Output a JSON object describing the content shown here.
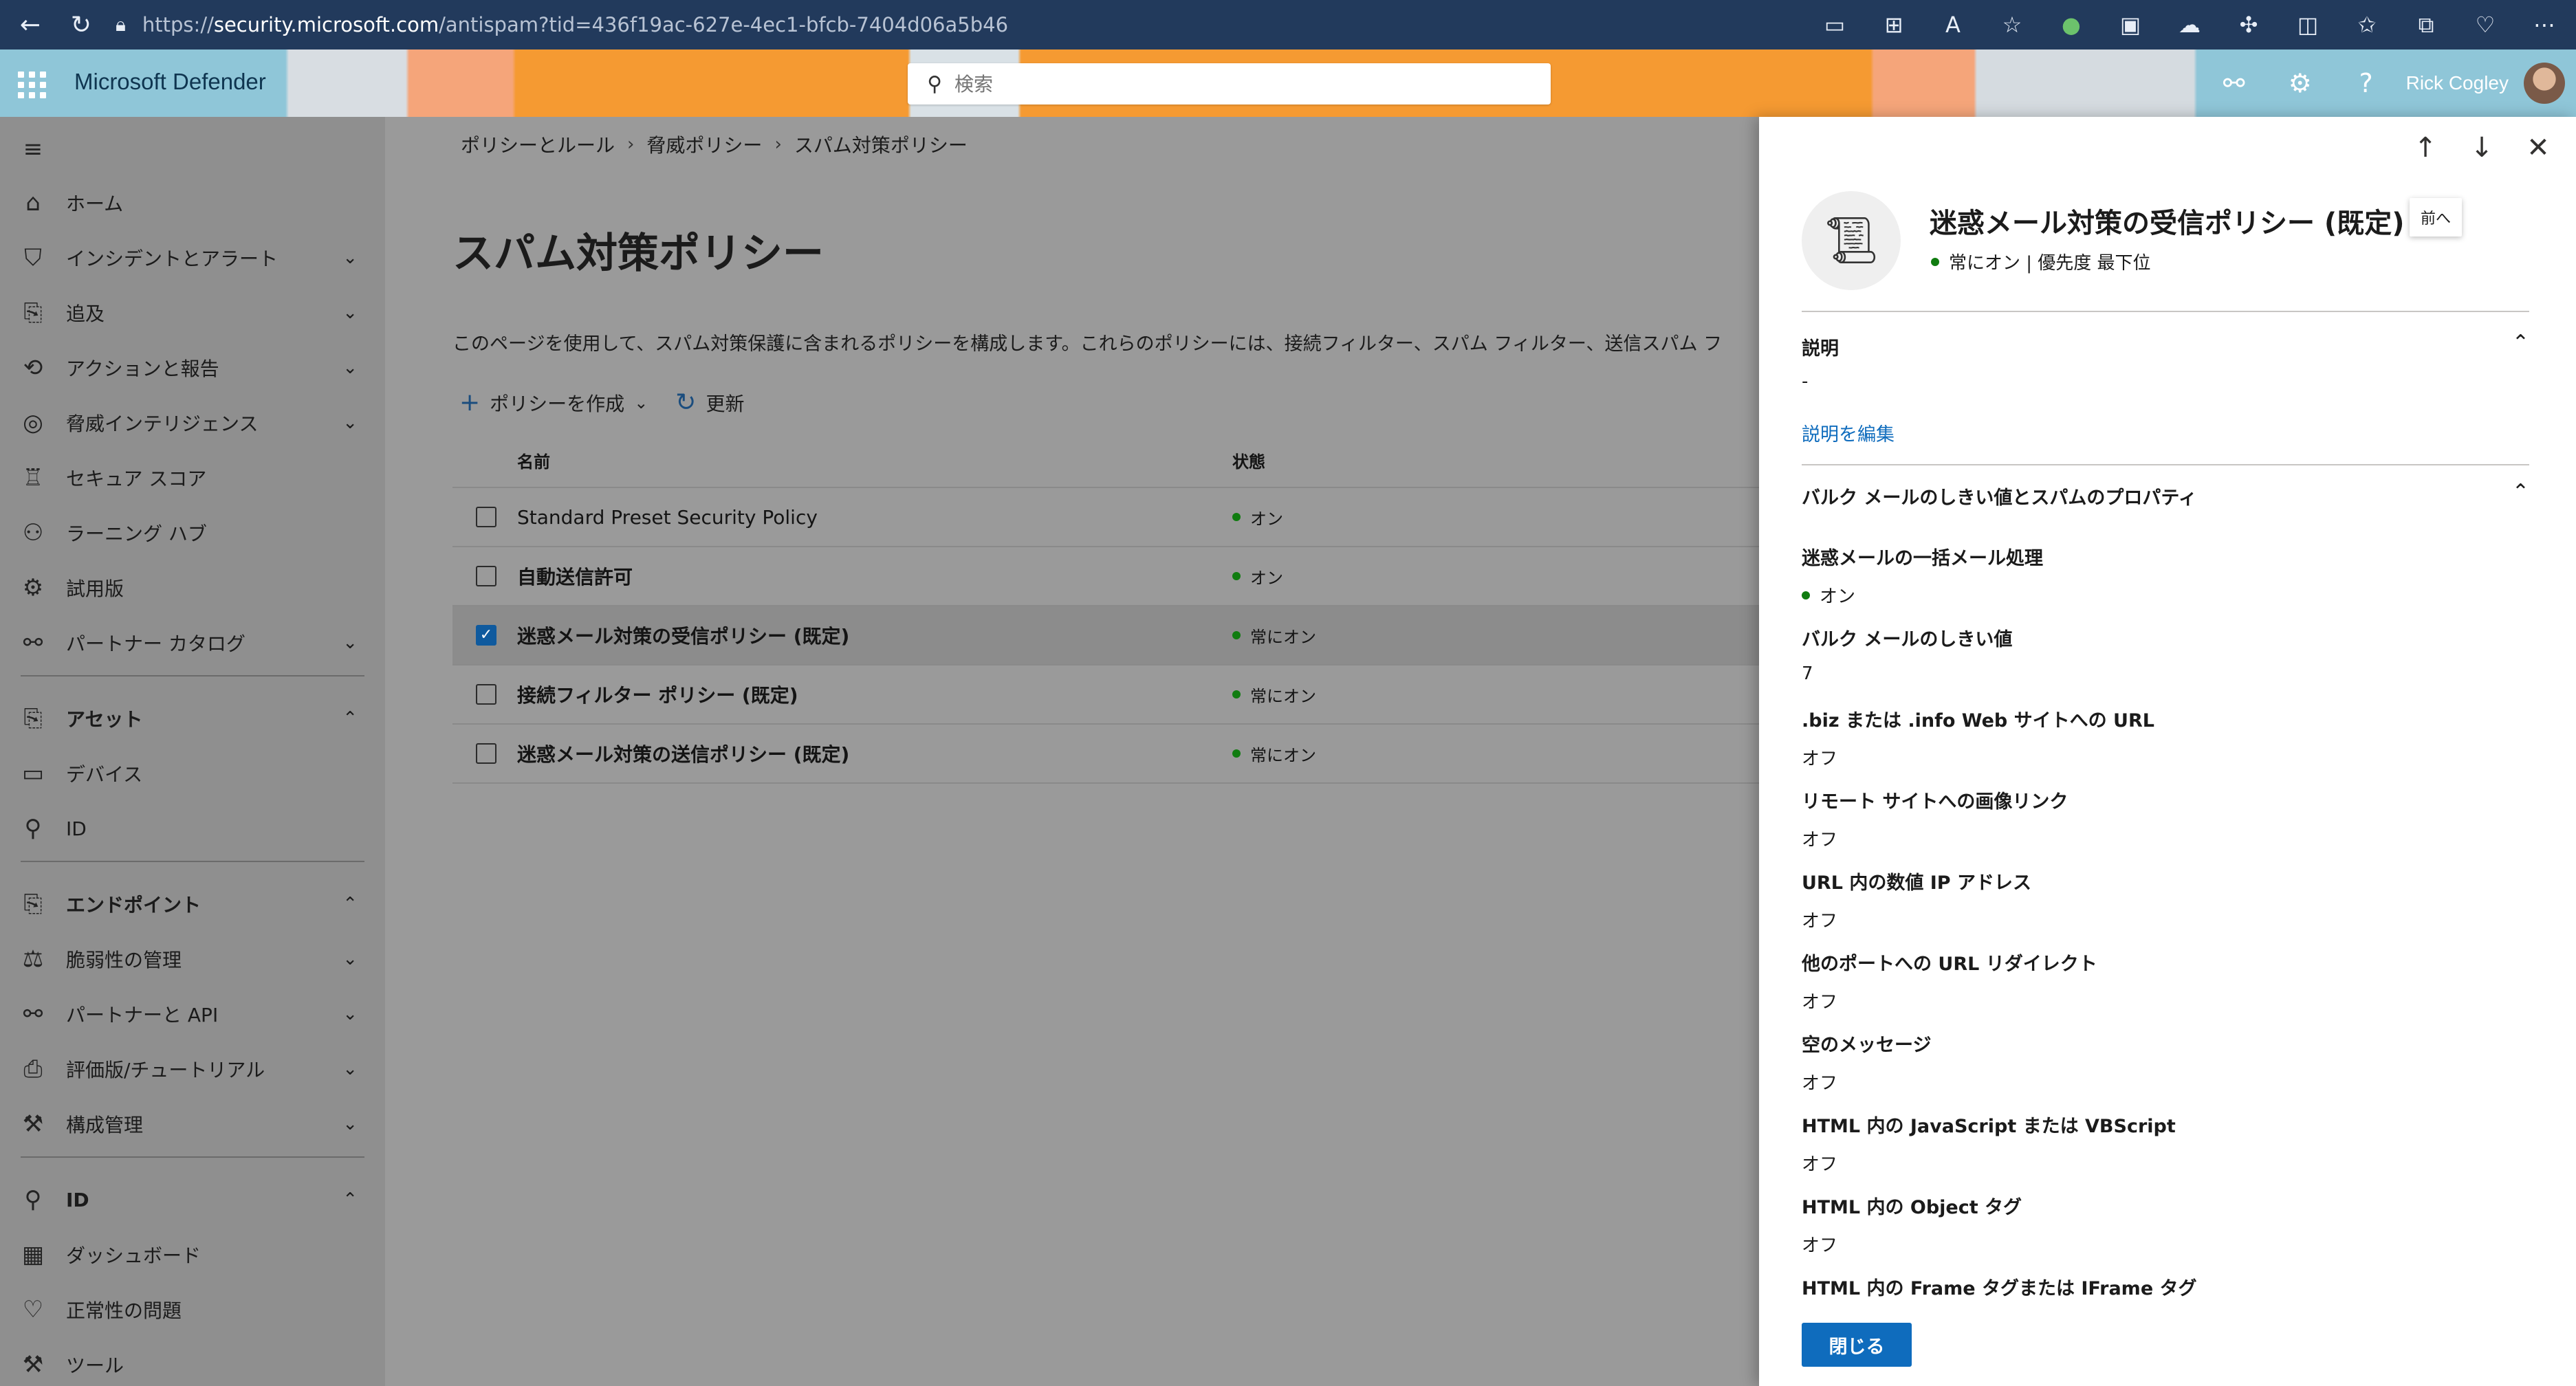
{
  "browser": {
    "url_prefix": "https://",
    "url_host": "security.microsoft.com",
    "url_path": "/antispam?tid=436f19ac-627e-4ec1-bfcb-7404d06a5b46"
  },
  "header": {
    "product": "Microsoft Defender",
    "search_placeholder": "検索",
    "user": "Rick Cogley"
  },
  "sidebar": {
    "items": [
      {
        "label": "ホーム",
        "icon": "home-icon",
        "glyph": "⌂",
        "chevron": ""
      },
      {
        "label": "インシデントとアラート",
        "icon": "shield-icon",
        "glyph": "⛉",
        "chevron": "⌄"
      },
      {
        "label": "追及",
        "icon": "hunting-icon",
        "glyph": "⎘",
        "chevron": "⌄"
      },
      {
        "label": "アクションと報告",
        "icon": "actions-icon",
        "glyph": "⟲",
        "chevron": "⌄"
      },
      {
        "label": "脅威インテリジェンス",
        "icon": "threat-intel-icon",
        "glyph": "◎",
        "chevron": "⌄"
      },
      {
        "label": "セキュア スコア",
        "icon": "trophy-icon",
        "glyph": "♖",
        "chevron": ""
      },
      {
        "label": "ラーニング ハブ",
        "icon": "learning-icon",
        "glyph": "⚇",
        "chevron": ""
      },
      {
        "label": "試用版",
        "icon": "trial-icon",
        "glyph": "⚙",
        "chevron": ""
      },
      {
        "label": "パートナー カタログ",
        "icon": "partner-icon",
        "glyph": "⚯",
        "chevron": "⌄"
      }
    ],
    "assets_head": {
      "label": "アセット",
      "chevron": "⌃"
    },
    "assets": [
      {
        "label": "デバイス",
        "icon": "device-icon",
        "glyph": "▭"
      },
      {
        "label": "ID",
        "icon": "person-icon",
        "glyph": "⚲"
      }
    ],
    "endpoint_head": {
      "label": "エンドポイント",
      "chevron": "⌃"
    },
    "endpoint": [
      {
        "label": "脆弱性の管理",
        "icon": "vulnerability-icon",
        "glyph": "⚖",
        "chevron": "⌄"
      },
      {
        "label": "パートナーと API",
        "icon": "api-icon",
        "glyph": "⚯",
        "chevron": "⌄"
      },
      {
        "label": "評価版/チュートリアル",
        "icon": "tutorial-icon",
        "glyph": "⎙",
        "chevron": "⌄"
      },
      {
        "label": "構成管理",
        "icon": "config-icon",
        "glyph": "⚒",
        "chevron": "⌄"
      }
    ],
    "id_head": {
      "label": "ID",
      "chevron": "⌃"
    },
    "id_items": [
      {
        "label": "ダッシュボード",
        "icon": "dashboard-icon",
        "glyph": "▦"
      },
      {
        "label": "正常性の問題",
        "icon": "health-icon",
        "glyph": "♡"
      },
      {
        "label": "ツール",
        "icon": "tools-icon",
        "glyph": "⚒"
      }
    ]
  },
  "breadcrumb": [
    "ポリシーとルール",
    "脅威ポリシー",
    "スパム対策ポリシー"
  ],
  "main": {
    "title": "スパム対策ポリシー",
    "description": "このページを使用して、スパム対策保護に含まれるポリシーを構成します。これらのポリシーには、接続フィルター、スパム フィルター、送信スパム フ",
    "create_label": "ポリシーを作成",
    "refresh_label": "更新"
  },
  "table": {
    "col_name": "名前",
    "col_status": "状態",
    "rows": [
      {
        "name": "Standard Preset Security Policy",
        "status": "オン",
        "checked": false
      },
      {
        "name": "自動送信許可",
        "status": "オン",
        "checked": false
      },
      {
        "name": "迷惑メール対策の受信ポリシー (既定)",
        "status": "常にオン",
        "checked": true
      },
      {
        "name": "接続フィルター ポリシー (既定)",
        "status": "常にオン",
        "checked": false
      },
      {
        "name": "迷惑メール対策の送信ポリシー (既定)",
        "status": "常にオン",
        "checked": false
      }
    ]
  },
  "panel": {
    "tooltip": "前へ",
    "title": "迷惑メール対策の受信ポリシー (既定)",
    "subtitle": "常にオン | 優先度 最下位",
    "description_head": "説明",
    "description_value": "-",
    "edit_description": "説明を編集",
    "bulk_head": "バルク メールのしきい値とスパムのプロパティ",
    "properties": [
      {
        "label": "迷惑メールの一括メール処理",
        "value": "オン",
        "dot": true
      },
      {
        "label": "バルク メールのしきい値",
        "value": "7",
        "dot": false
      },
      {
        "label": ".biz または .info Web サイトへの URL",
        "value": "オフ",
        "dot": false
      },
      {
        "label": "リモート サイトへの画像リンク",
        "value": "オフ",
        "dot": false
      },
      {
        "label": "URL 内の数値 IP アドレス",
        "value": "オフ",
        "dot": false
      },
      {
        "label": "他のポートへの URL リダイレクト",
        "value": "オフ",
        "dot": false
      },
      {
        "label": "空のメッセージ",
        "value": "オフ",
        "dot": false
      },
      {
        "label": "HTML 内の JavaScript または VBScript",
        "value": "オフ",
        "dot": false
      },
      {
        "label": "HTML 内の Object タグ",
        "value": "オフ",
        "dot": false
      },
      {
        "label": "HTML 内の Frame タグまたは IFrame タグ",
        "value": "",
        "dot": false
      }
    ],
    "close_label": "閉じる"
  },
  "colors": {
    "accent": "#0f6cbd",
    "status_green": "#107c10",
    "browser_bar": "#223a5c"
  }
}
